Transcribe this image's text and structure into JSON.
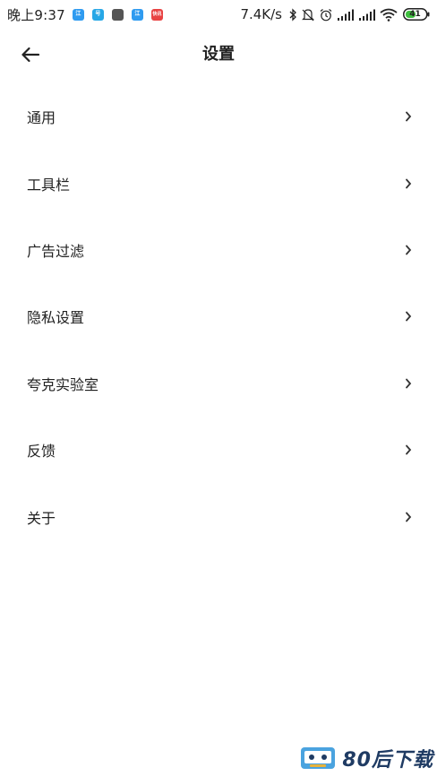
{
  "status_bar": {
    "time": "晚上9:37",
    "net_speed": "7.4K/s",
    "battery": "41",
    "notification_icons": [
      {
        "name": "app-notif-icon-1",
        "color": "#2f9bf0",
        "text": "江"
      },
      {
        "name": "app-notif-icon-2",
        "color": "#27a7e6",
        "text": "号"
      },
      {
        "name": "app-notif-icon-3",
        "color": "#555555",
        "text": ""
      },
      {
        "name": "app-notif-icon-4",
        "color": "#2f9bf0",
        "text": "江"
      },
      {
        "name": "app-notif-icon-5",
        "color": "#e84343",
        "text": "快讯"
      }
    ]
  },
  "header": {
    "title": "设置",
    "back_icon": "arrow-left-icon"
  },
  "settings": {
    "items": [
      {
        "label": "通用"
      },
      {
        "label": "工具栏"
      },
      {
        "label": "广告过滤"
      },
      {
        "label": "隐私设置"
      },
      {
        "label": "夸克实验室"
      },
      {
        "label": "反馈"
      },
      {
        "label": "关于"
      }
    ]
  },
  "watermark": {
    "text": "80后下载",
    "color": "#1f3b63",
    "accent": "#4aa3df"
  }
}
